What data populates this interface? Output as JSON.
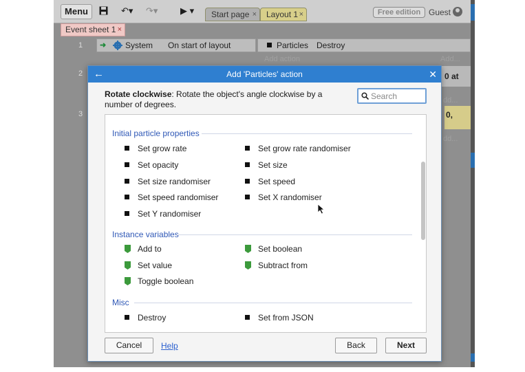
{
  "toolbar": {
    "menu_label": "Menu",
    "save_icon": "save-icon",
    "undo_icon": "undo-icon",
    "redo_icon": "redo-icon",
    "play_icon": "play-icon",
    "tabs": [
      {
        "label": "Start page",
        "close": "×"
      },
      {
        "label": "Layout 1",
        "close": "×"
      }
    ],
    "badge": "Free edition",
    "user": "Guest"
  },
  "sheet_tab": {
    "label": "Event sheet 1",
    "close": "×"
  },
  "event_sheet": {
    "row_numbers": [
      "1",
      "2",
      "3"
    ],
    "condition_object": "System",
    "condition_text": "On start of layout",
    "action_object": "Particles",
    "action_text": "Destroy",
    "add_action": "Add action",
    "add_right": "Add...",
    "row2_right": "0 at",
    "row3_right": "0,",
    "faint_right_1": "dd...",
    "faint_right_2": "dd..."
  },
  "dialog": {
    "title": "Add 'Particles' action",
    "description_title": "Rotate clockwise",
    "description_body": ": Rotate the object's angle clockwise by a number of degrees.",
    "search_placeholder": "Search",
    "sections": [
      {
        "header": "Initial particle properties",
        "icon": "square-bullet",
        "items": [
          "Set grow rate",
          "Set grow rate randomiser",
          "Set opacity",
          "Set size",
          "Set size randomiser",
          "Set speed",
          "Set speed randomiser",
          "Set X randomiser",
          "Set Y randomiser"
        ]
      },
      {
        "header": "Instance variables",
        "icon": "instance-variable-icon",
        "items": [
          "Add to",
          "Set boolean",
          "Set value",
          "Subtract from",
          "Toggle boolean"
        ]
      },
      {
        "header": "Misc",
        "icon": "square-bullet",
        "items": [
          "Destroy",
          "Set from JSON"
        ]
      }
    ],
    "buttons": {
      "cancel": "Cancel",
      "help": "Help",
      "back": "Back",
      "next": "Next"
    }
  },
  "colors": {
    "title_bar": "#2f7fd0",
    "section_header": "#2f58b6",
    "instance_var_green": "#3c9a3c",
    "event_sheet_tab": "#f0c9c6",
    "layout_tab": "#d8cf8a"
  }
}
